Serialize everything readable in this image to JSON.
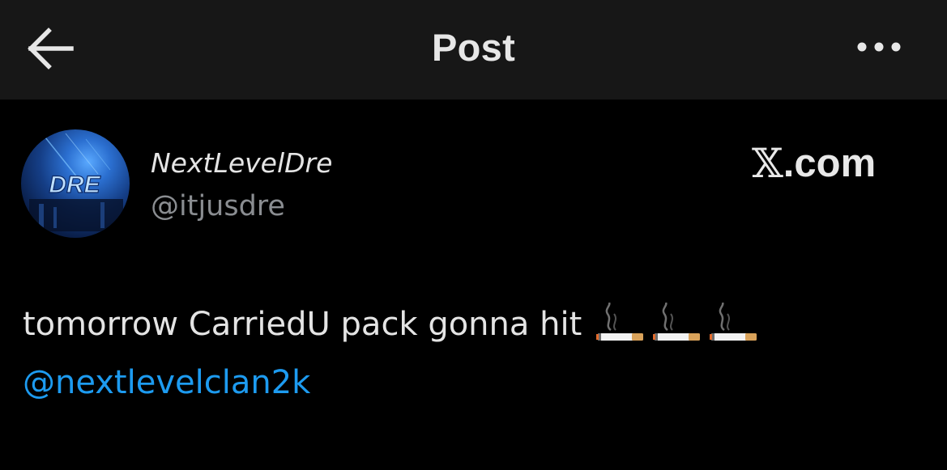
{
  "header": {
    "title": "Post",
    "back_icon": "arrow-left-icon",
    "more_icon": "more-horizontal-icon"
  },
  "author": {
    "display_name": "NextLevelDre",
    "handle": "@itjusdre",
    "avatar_text": "DRE"
  },
  "brand": {
    "x_mark": "𝕏",
    "domain": ".com"
  },
  "post": {
    "text": "tomorrow CarriedU pack gonna hit",
    "emojis": [
      "smoking-icon",
      "smoking-icon",
      "smoking-icon"
    ],
    "mention": "@nextlevelclan2k"
  },
  "colors": {
    "background": "#000000",
    "topbar": "#171717",
    "text": "#e4e4e4",
    "secondary_text": "#8a8d91",
    "link": "#1d9bf0"
  }
}
